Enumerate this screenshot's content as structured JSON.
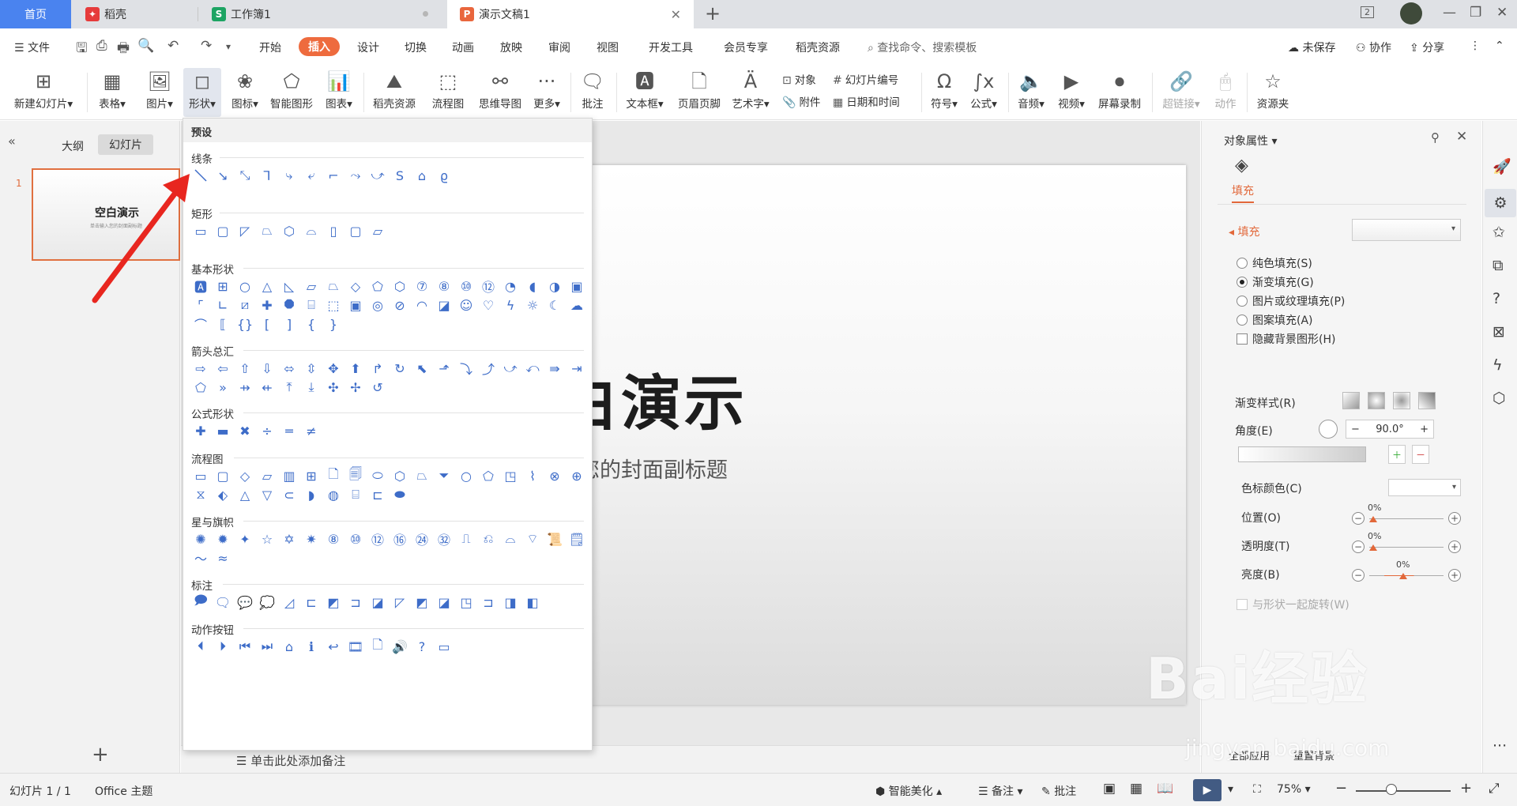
{
  "tabs": {
    "home": "首页",
    "daoke": "稻壳",
    "workbook": "工作簿1",
    "document": "演示文稿1"
  },
  "window": {
    "badge": "2"
  },
  "menubar": {
    "file": "文件",
    "items": [
      "开始",
      "插入",
      "设计",
      "切换",
      "动画",
      "放映",
      "审阅",
      "视图",
      "开发工具",
      "会员专享",
      "稻壳资源"
    ],
    "active": "插入",
    "search": "查找命令、搜索模板",
    "unsaved": "未保存",
    "collab": "协作",
    "share": "分享"
  },
  "ribbon": {
    "new_slide": "新建幻灯片",
    "table": "表格",
    "picture": "图片",
    "shape": "形状",
    "icon": "图标",
    "smart_shape": "智能图形",
    "chart": "图表",
    "daoke_res": "稻壳资源",
    "flowchart": "流程图",
    "mindmap": "思维导图",
    "more": "更多",
    "comment": "批注",
    "textbox": "文本框",
    "header_footer": "页眉页脚",
    "wordart": "艺术字",
    "object": "对象",
    "slide_number": "幻灯片编号",
    "attachment": "附件",
    "date_time": "日期和时间",
    "symbol": "符号",
    "formula": "公式",
    "audio": "音频",
    "video": "视频",
    "screen_record": "屏幕录制",
    "hyperlink": "超链接",
    "action": "动作",
    "resource_folder": "资源夹"
  },
  "left_panel": {
    "outline_tab": "大纲",
    "slides_tab": "幻灯片",
    "slide_number": "1",
    "thumb_title": "空白演示",
    "thumb_subtitle": "单击输入您的封面副标题"
  },
  "slide": {
    "title": "空白演示",
    "subtitle": "击输入您的封面副标题"
  },
  "notes": {
    "placeholder": "单击此处添加备注"
  },
  "shapes_panel": {
    "preset": "预设",
    "categories": {
      "lines": "线条",
      "rectangles": "矩形",
      "basic": "基本形状",
      "arrows": "箭头总汇",
      "equation": "公式形状",
      "flowchart": "流程图",
      "stars": "星与旗帜",
      "callouts": "标注",
      "action_buttons": "动作按钮"
    }
  },
  "right_pane": {
    "title": "对象属性",
    "fill_tab": "填充",
    "fill_section": "填充",
    "options": [
      "纯色填充(S)",
      "渐变填充(G)",
      "图片或纹理填充(P)",
      "图案填充(A)"
    ],
    "selected_option": "渐变填充(G)",
    "hide_bg": "隐藏背景图形(H)",
    "gradient_style": "渐变样式(R)",
    "angle_label": "角度(E)",
    "angle_value": "90.0°",
    "stop_color": "色标颜色(C)",
    "position": "位置(O)",
    "position_value": "0%",
    "transparency": "透明度(T)",
    "transparency_value": "0%",
    "brightness": "亮度(B)",
    "brightness_value": "0%",
    "rotate_with_shape": "与形状一起旋转(W)",
    "apply_all": "全部应用",
    "reset_bg": "重置背景"
  },
  "statusbar": {
    "slide_pos": "幻灯片 1 / 1",
    "theme": "Office 主题",
    "beautify": "智能美化",
    "notes": "备注",
    "comments": "批注",
    "zoom": "75%"
  },
  "watermark": {
    "text": "Bai经验",
    "url": "jingyan.baidu.com"
  }
}
